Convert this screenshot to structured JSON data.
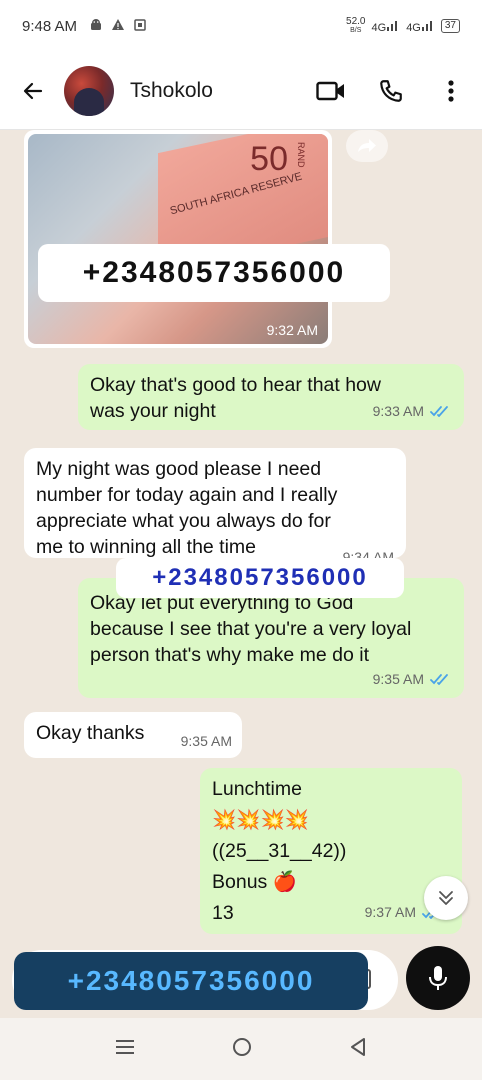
{
  "status": {
    "time": "9:48 AM",
    "speed_top": "52.0",
    "speed_unit": "B/S",
    "net1": "4G",
    "net2": "4G",
    "battery": "37"
  },
  "header": {
    "contact_name": "Tshokolo"
  },
  "messages": [
    {
      "type": "image",
      "direction": "in",
      "time": "9:32 AM",
      "note_value": "50",
      "note_currency": "RAND",
      "note_text": "SOUTH AFRICA RESERVE"
    },
    {
      "direction": "out",
      "text_lines": [
        "Okay that's good to hear that how",
        "was your night"
      ],
      "time": "9:33 AM"
    },
    {
      "direction": "in",
      "text_lines": [
        "My night was good please I need",
        "number for today again and I really",
        "appreciate what you always do for",
        "me to winning all the time"
      ],
      "time": "9:34 AM"
    },
    {
      "direction": "out",
      "text_lines": [
        "Okay let put everything to God",
        "because I see that you're a very loyal",
        "person that's why make me do it"
      ],
      "time": "9:35 AM"
    },
    {
      "direction": "in",
      "text_lines": [
        "Okay thanks"
      ],
      "time": "9:35 AM"
    },
    {
      "direction": "out",
      "text_lines": [
        "Lunchtime",
        "💥💥💥💥",
        "((25__31__42))",
        "Bonus 🍎",
        "13"
      ],
      "time": "9:37 AM"
    }
  ],
  "overlays": {
    "number": "+2348057356000"
  },
  "colors": {
    "outgoing": "#dcf8c6",
    "incoming": "#ffffff",
    "tick": "#4aa3e8",
    "overlay_blue": "#1f2fb5",
    "composer_banner": "#163f61"
  }
}
